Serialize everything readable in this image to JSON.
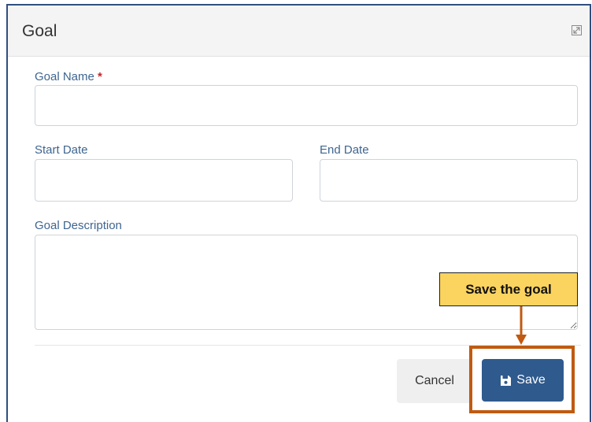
{
  "dialog": {
    "title": "Goal",
    "expand_icon": "expand-icon"
  },
  "form": {
    "goal_name": {
      "label": "Goal Name",
      "required_marker": "*",
      "value": ""
    },
    "start_date": {
      "label": "Start Date",
      "value": ""
    },
    "end_date": {
      "label": "End Date",
      "value": ""
    },
    "goal_description": {
      "label": "Goal Description",
      "value": ""
    }
  },
  "footer": {
    "cancel_label": "Cancel",
    "save_label": "Save",
    "save_icon": "floppy-disk-icon"
  },
  "callout": {
    "text": "Save the goal",
    "colors": {
      "fill": "#fbd35f",
      "highlight": "#c05a11"
    }
  },
  "colors": {
    "label": "#3e6590",
    "required": "#c0272d",
    "primary_button": "#2f5a8e",
    "dialog_border": "#2f4f7f"
  }
}
